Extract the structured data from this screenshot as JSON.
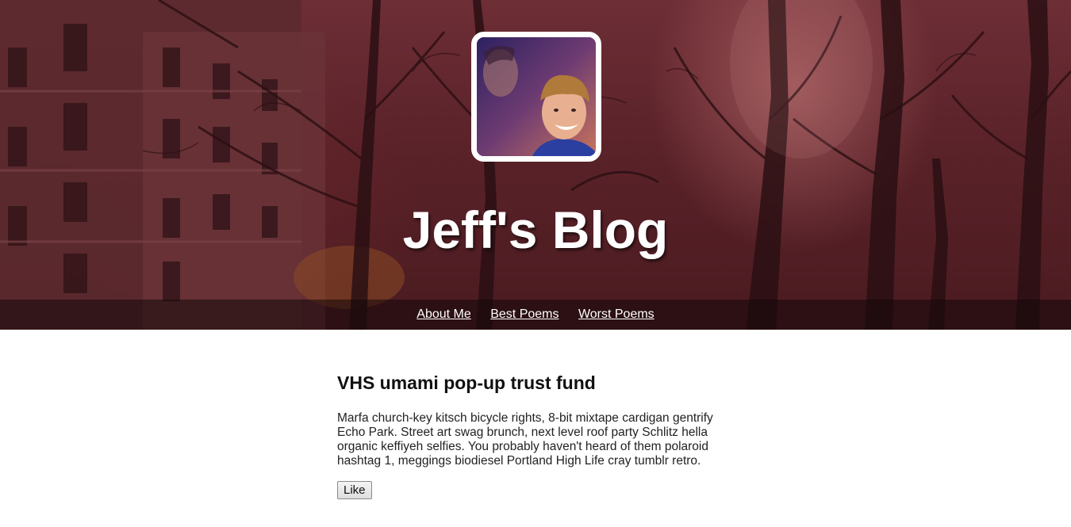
{
  "header": {
    "site_title": "Jeff's Blog",
    "avatar_icon": "profile-photo-icon"
  },
  "nav": {
    "items": [
      {
        "label": "About Me"
      },
      {
        "label": "Best Poems"
      },
      {
        "label": "Worst Poems"
      }
    ]
  },
  "post": {
    "title": "VHS umami pop-up trust fund",
    "body": "Marfa church-key kitsch bicycle rights, 8-bit mixtape cardigan gentrify Echo Park. Street art swag brunch, next level roof party Schlitz hella organic keffiyeh selfies. You probably haven't heard of them polaroid hashtag 1, meggings biodiesel Portland High Life cray tumblr retro.",
    "like_label": "Like"
  },
  "colors": {
    "hero_tint": "#5a2229",
    "nav_text": "#ffffff"
  }
}
